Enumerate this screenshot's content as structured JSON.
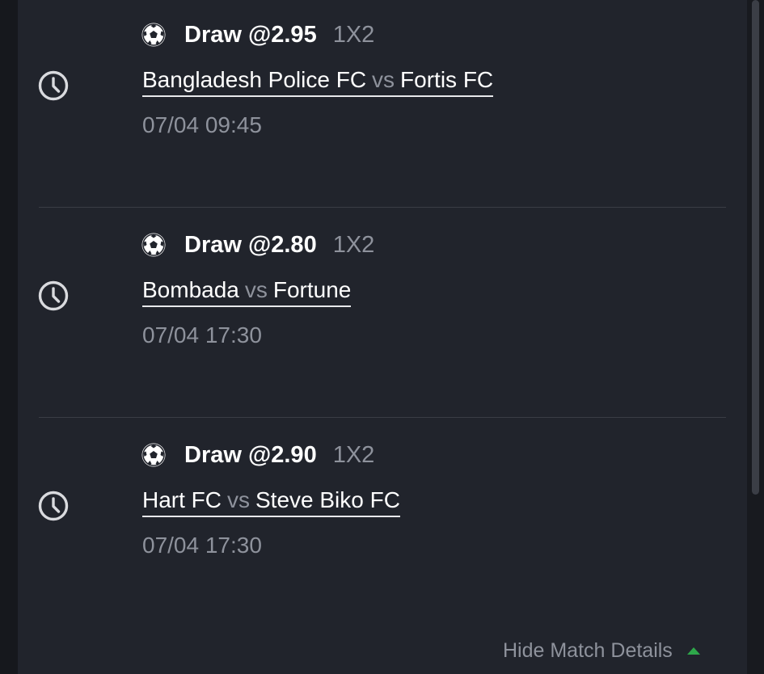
{
  "bets": [
    {
      "selection": "Draw @2.95",
      "market": "1X2",
      "home": "Bangladesh Police FC",
      "vs": "vs",
      "away": "Fortis FC",
      "kickoff": "07/04 09:45"
    },
    {
      "selection": "Draw @2.80",
      "market": "1X2",
      "home": "Bombada",
      "vs": "vs",
      "away": "Fortune",
      "kickoff": "07/04 17:30"
    },
    {
      "selection": "Draw @2.90",
      "market": "1X2",
      "home": "Hart FC",
      "vs": "vs",
      "away": "Steve Biko FC",
      "kickoff": "07/04 17:30"
    }
  ],
  "footer": {
    "toggle_label": "Hide Match Details"
  },
  "icons": {
    "status": "clock-icon",
    "sport": "soccer-ball-icon",
    "toggle": "caret-up-icon"
  },
  "colors": {
    "background": "#21242c",
    "text_primary": "#ffffff",
    "text_secondary": "#8e929c",
    "accent": "#2ea84a"
  }
}
